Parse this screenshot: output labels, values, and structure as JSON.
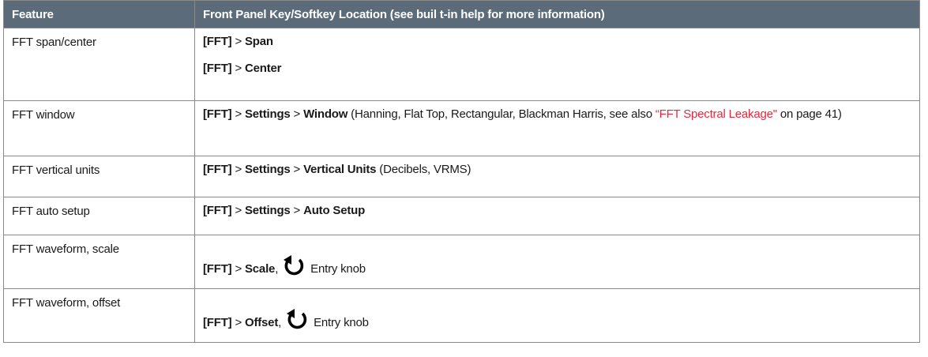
{
  "header": {
    "col1": "Feature",
    "col2": "Front Panel Key/Softkey Location (see buil t-in help for more information)"
  },
  "rows": [
    {
      "feature": "FFT span/center",
      "lines": [
        {
          "key": "[FFT]",
          "sep": " > ",
          "item": "Span"
        },
        {
          "key": "[FFT]",
          "sep": " > ",
          "item": "Center"
        }
      ]
    },
    {
      "feature": "FFT window",
      "key": "[FFT]",
      "sep1": " > ",
      "item1": "Settings",
      "sep2": " > ",
      "item2": "Window",
      "text": " (Hanning, Flat Top, Rectangular, Blackman Harris, see also ",
      "link": "“FFT Spectral Leakage\"",
      "tail": " on page 41)"
    },
    {
      "feature": "FFT vertical units",
      "key": "[FFT]",
      "sep1": " > ",
      "item1": "Settings",
      "sep2": " > ",
      "item2": "Vertical Units",
      "text": " (Decibels, VRMS)"
    },
    {
      "feature": "FFT auto setup",
      "key": "[FFT]",
      "sep1": " > ",
      "item1": "Settings",
      "sep2": " > ",
      "item2": "Auto Setup"
    },
    {
      "feature": "FFT waveform, scale",
      "key": "[FFT]",
      "sep1": " > ",
      "item1": "Scale",
      "comma": ",",
      "knob_label": "Entry knob",
      "icon": "entry-knob-icon"
    },
    {
      "feature": "FFT waveform, offset",
      "key": "[FFT]",
      "sep1": " > ",
      "item1": "Offset",
      "comma": ",",
      "knob_label": "Entry knob",
      "icon": "entry-knob-icon"
    }
  ],
  "colors": {
    "header_bg": "#5c6b7a",
    "link": "#e8283c",
    "border": "#8a8a8a"
  }
}
